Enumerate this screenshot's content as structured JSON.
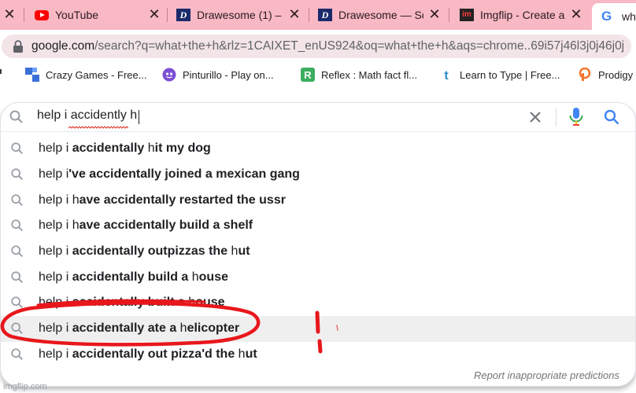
{
  "tabs": [
    {
      "title": "YouTube",
      "favicon": "youtube-icon",
      "active": false
    },
    {
      "title": "Drawesome (1) – ",
      "favicon": "drawesome-icon",
      "active": false
    },
    {
      "title": "Drawesome — Sc",
      "favicon": "drawesome-icon",
      "active": false
    },
    {
      "title": "Imgflip - Create a",
      "favicon": "imgflip-icon",
      "active": false
    },
    {
      "title": "wh",
      "favicon": "google-icon",
      "active": true
    }
  ],
  "tab_close_glyph": "✕",
  "address_bar": {
    "host": "google.com",
    "path": "/search?q=what+the+h&rlz=1CAIXET_enUS924&oq=what+the+h&aqs=chrome..69i57j46l3j0j46j0j"
  },
  "bookmarks": [
    {
      "label": "Crazy Games - Free...",
      "icon": "crazy-games-icon"
    },
    {
      "label": "Pinturillo - Play on...",
      "icon": "pinturillo-icon"
    },
    {
      "label": "Reflex : Math fact fl...",
      "icon": "reflex-icon"
    },
    {
      "label": "Learn to Type | Free...",
      "icon": "typing-icon"
    },
    {
      "label": "Prodigy",
      "icon": "prodigy-icon"
    }
  ],
  "search": {
    "query": "help i accidently h",
    "suggestions": [
      {
        "typed": "help i ",
        "bold": "accidentally",
        "rest_typed": " h",
        "rest_bold": "it my dog"
      },
      {
        "typed": "help i",
        "bold": "'ve accidentally joined a mexican gang",
        "rest_typed": "",
        "rest_bold": ""
      },
      {
        "typed": "help i h",
        "bold": "ave accidentally restarted the ussr",
        "rest_typed": "",
        "rest_bold": ""
      },
      {
        "typed": "help i h",
        "bold": "ave accidentally build a shelf",
        "rest_typed": "",
        "rest_bold": ""
      },
      {
        "typed": "help i ",
        "bold": "accidentally outpizzas the",
        "rest_typed": " h",
        "rest_bold": "ut"
      },
      {
        "typed": "help i ",
        "bold": "accidentally build a",
        "rest_typed": " h",
        "rest_bold": "ouse"
      },
      {
        "typed": "help i ",
        "bold": "accidentally built a",
        "rest_typed": " h",
        "rest_bold": "ouse"
      },
      {
        "typed": "help i ",
        "bold": "accidentally ate a",
        "rest_typed": " h",
        "rest_bold": "elicopter"
      },
      {
        "typed": "help i ",
        "bold": "accidentally out pizza'd the",
        "rest_typed": " h",
        "rest_bold": "ut"
      }
    ],
    "highlighted_index": 7,
    "report_link": "Report inappropriate predictions"
  },
  "watermark": "imgflip.com",
  "colors": {
    "tabstrip": "#f8b8c4",
    "google_blue": "#4285f4",
    "annotation_red": "#e8171c"
  }
}
